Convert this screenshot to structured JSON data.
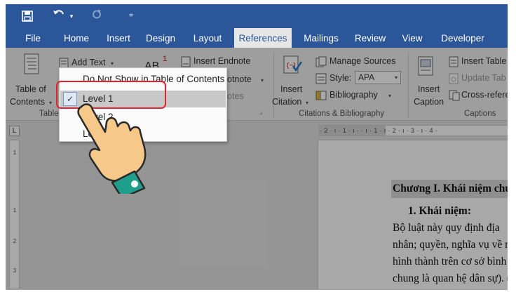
{
  "colors": {
    "title_bar": "#2b579a",
    "ribbon_bg": "#f0f0f0",
    "highlight_ring": "#e3232a",
    "hand_skin": "#f6c98a",
    "hand_cuff": "#1f9e8c"
  },
  "quick_access": {
    "save_icon": "floppy-disk-icon",
    "undo_icon": "undo-arrow-icon",
    "redo_icon": "redo-arrow-icon",
    "customize": "="
  },
  "tabs": [
    {
      "label": "File"
    },
    {
      "label": "Home"
    },
    {
      "label": "Insert"
    },
    {
      "label": "Design"
    },
    {
      "label": "Layout"
    },
    {
      "label": "References",
      "active": true
    },
    {
      "label": "Mailings"
    },
    {
      "label": "Review"
    },
    {
      "label": "View"
    },
    {
      "label": "Developer"
    }
  ],
  "ribbon": {
    "toc": {
      "label_line1": "Table of",
      "label_line2": "Contents",
      "group_label": "Table"
    },
    "add_text": "Add Text",
    "footnotes": {
      "insert_footnote_icon_text": "AB",
      "footnote_superscript": "1",
      "insert_endnote": "Insert Endnote",
      "next_footnote": "otnote",
      "show_notes": "otes"
    },
    "citations": {
      "insert_citation_line1": "Insert",
      "insert_citation_line2": "Citation",
      "manage_sources": "Manage Sources",
      "style_label": "Style:",
      "style_value": "APA",
      "bibliography": "Bibliography",
      "group_label": "Citations & Bibliography"
    },
    "captions": {
      "insert_caption_line1": "Insert",
      "insert_caption_line2": "Caption",
      "insert_table": "Insert Table",
      "update_table": "Update Tab",
      "cross_reference": "Cross-refere",
      "group_label": "Captions"
    }
  },
  "dropdown": {
    "items": [
      {
        "label": "Do Not Show in Table of Contents",
        "checked": false
      },
      {
        "label": "Level 1",
        "checked": true
      },
      {
        "label": "Level 2",
        "checked": false
      },
      {
        "label": "Level 3",
        "checked": false
      }
    ]
  },
  "ruler": {
    "corner": "L",
    "horizontal_text": "· 2 · ı · 1 · ı ·   · ı · 1 · ı · 2 · ı · 3 · ı · 4 ·",
    "vertical_marks": [
      "1",
      "1",
      "2",
      "3"
    ]
  },
  "document": {
    "heading": "Chương I. Khái niệm chu",
    "subheading": "1.   Khái niệm:",
    "lines": [
      "Bộ luật này quy định địa",
      "nhân; quyền, nghĩa vụ về n",
      "hình thành trên cơ sở bình",
      "chung là quan hệ dân sự). ("
    ]
  }
}
